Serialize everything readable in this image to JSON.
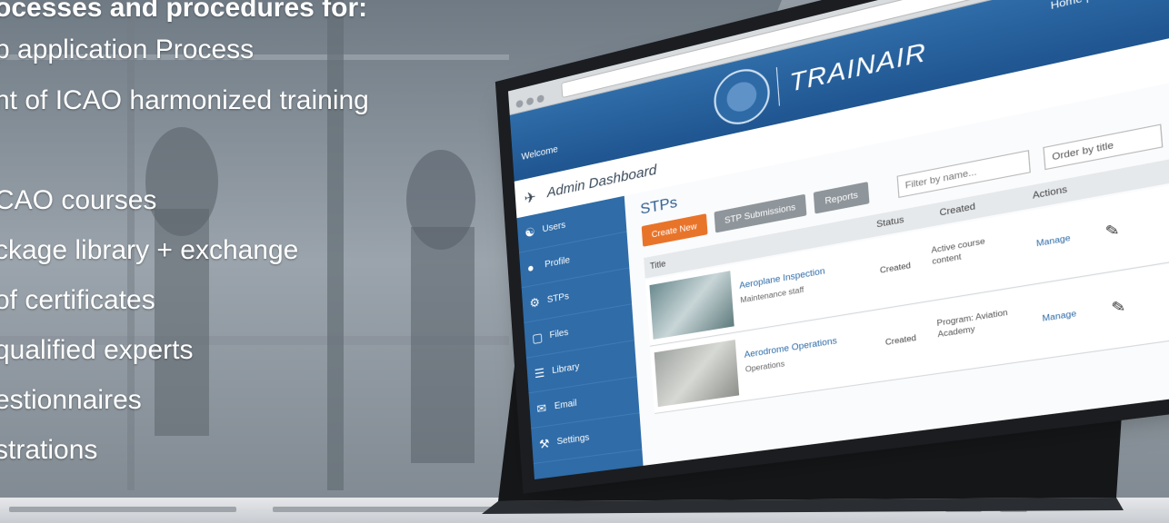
{
  "slide": {
    "heading": "ocesses and procedures for:",
    "bullets": [
      "p application Process",
      "nt of ICAO harmonized training",
      "CAO courses",
      "ckage library + exchange",
      " of certificates",
      "qualified experts",
      "estionnaires",
      "strations"
    ]
  },
  "app": {
    "brand": "TRAINAIR",
    "top_links": "Home | Logout | Help",
    "user": "Welcome",
    "dashboard_title": "Admin Dashboard",
    "sidebar": [
      {
        "icon": "users-icon",
        "label": "Users"
      },
      {
        "icon": "user-icon",
        "label": "Profile"
      },
      {
        "icon": "stp-icon",
        "label": "STPs"
      },
      {
        "icon": "folder-icon",
        "label": "Files"
      },
      {
        "icon": "library-icon",
        "label": "Library"
      },
      {
        "icon": "mail-icon",
        "label": "Email"
      },
      {
        "icon": "settings-icon",
        "label": "Settings"
      }
    ],
    "section_title": "STPs",
    "tabs": [
      "Create New",
      "STP Submissions",
      "Reports"
    ],
    "search_placeholder": "Filter by name...",
    "sort_label": "Order by title",
    "columns": {
      "title": "Title",
      "status": "Status",
      "created": "Created",
      "actions": "Actions"
    },
    "rows": [
      {
        "title": "Aeroplane Inspection",
        "sub": "Maintenance staff",
        "status": "Created",
        "meta": "Active course content",
        "action": "Manage"
      },
      {
        "title": "Aerodrome Operations",
        "sub": "Operations",
        "status": "Created",
        "meta": "Program: Aviation Academy",
        "action": "Manage"
      }
    ],
    "colors": {
      "header": "#2f6ca8",
      "accent": "#e8742a",
      "tab_grey": "#8e959b"
    }
  }
}
